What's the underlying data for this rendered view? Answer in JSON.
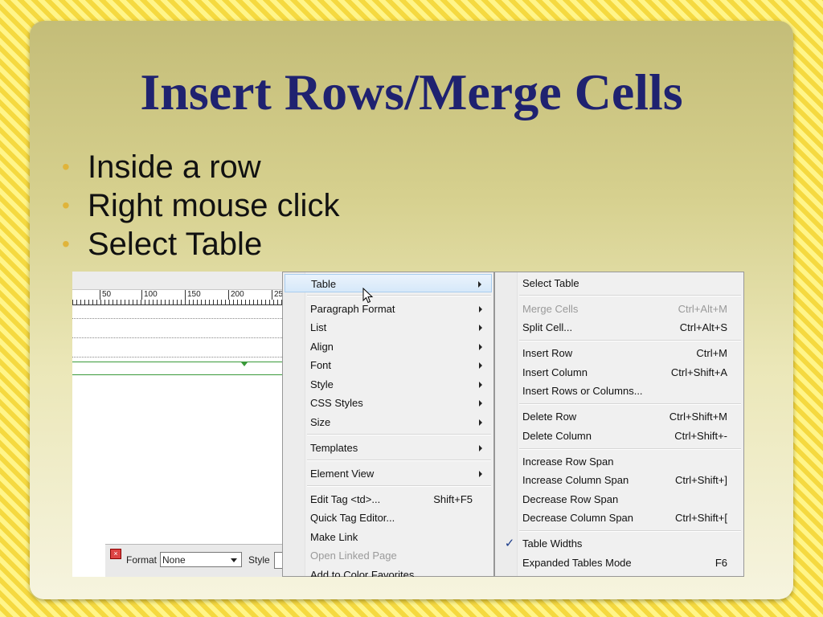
{
  "slide": {
    "title": "Insert Rows/Merge Cells",
    "bullets": [
      "Inside a row",
      "Right mouse click",
      "Select Table"
    ],
    "bullet_color": "#e0b43a",
    "title_color": "#1f2270"
  },
  "editor": {
    "ruler_ticks": [
      "50",
      "100",
      "150",
      "200",
      "25"
    ],
    "props": {
      "format_label": "Format",
      "format_value": "None",
      "style_label": "Style"
    }
  },
  "context_menu": {
    "items": [
      {
        "label": "Table",
        "submenu": true,
        "highlighted": true
      },
      {
        "label": "Paragraph Format",
        "submenu": true
      },
      {
        "label": "List",
        "submenu": true
      },
      {
        "label": "Align",
        "submenu": true
      },
      {
        "label": "Font",
        "submenu": true
      },
      {
        "label": "Style",
        "submenu": true
      },
      {
        "label": "CSS Styles",
        "submenu": true
      },
      {
        "label": "Size",
        "submenu": true
      },
      {
        "label": "Templates",
        "submenu": true
      },
      {
        "label": "Element View",
        "submenu": true
      },
      {
        "label": "Edit Tag <td>...",
        "shortcut": "Shift+F5"
      },
      {
        "label": "Quick Tag Editor..."
      },
      {
        "label": "Make Link"
      },
      {
        "label": "Open Linked Page",
        "disabled": true
      },
      {
        "label": "Add to Color Favorites"
      }
    ]
  },
  "table_submenu": {
    "items": [
      {
        "label": "Select Table"
      },
      {
        "label": "Merge Cells",
        "shortcut": "Ctrl+Alt+M",
        "disabled": true
      },
      {
        "label": "Split Cell...",
        "shortcut": "Ctrl+Alt+S"
      },
      {
        "label": "Insert Row",
        "shortcut": "Ctrl+M"
      },
      {
        "label": "Insert Column",
        "shortcut": "Ctrl+Shift+A"
      },
      {
        "label": "Insert Rows or Columns..."
      },
      {
        "label": "Delete Row",
        "shortcut": "Ctrl+Shift+M"
      },
      {
        "label": "Delete Column",
        "shortcut": "Ctrl+Shift+-"
      },
      {
        "label": "Increase Row Span"
      },
      {
        "label": "Increase Column Span",
        "shortcut": "Ctrl+Shift+]"
      },
      {
        "label": "Decrease Row Span"
      },
      {
        "label": "Decrease Column Span",
        "shortcut": "Ctrl+Shift+["
      },
      {
        "label": "Table Widths",
        "checked": true
      },
      {
        "label": "Expanded Tables Mode",
        "shortcut": "F6"
      }
    ],
    "check_glyph": "✓"
  }
}
